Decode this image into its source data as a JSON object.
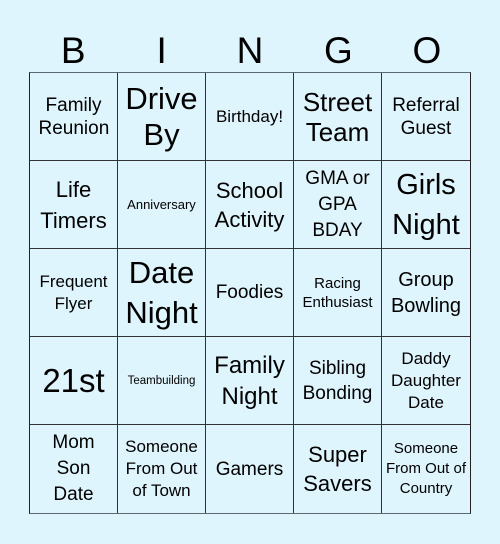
{
  "header": {
    "letters": [
      "B",
      "I",
      "N",
      "G",
      "O"
    ]
  },
  "board": {
    "rows": [
      [
        "Family Reunion",
        "Drive By",
        "Birthday!",
        "Street Team",
        "Referral Guest"
      ],
      [
        "Life Timers",
        "Anniversary",
        "School Activity",
        "GMA or GPA BDAY",
        "Girls Night"
      ],
      [
        "Frequent Flyer",
        "Date Night",
        "Foodies",
        "Racing Enthusiast",
        "Group Bowling"
      ],
      [
        "21st",
        "Teambuilding",
        "Family Night",
        "Sibling Bonding",
        "Daddy Daughter Date"
      ],
      [
        "Mom Son Date",
        "Someone From Out of Town",
        "Gamers",
        "Super Savers",
        "Someone From Out of Country"
      ]
    ]
  },
  "colors": {
    "background": "#dff5fd",
    "grid_line": "#333333",
    "text": "#000000"
  }
}
